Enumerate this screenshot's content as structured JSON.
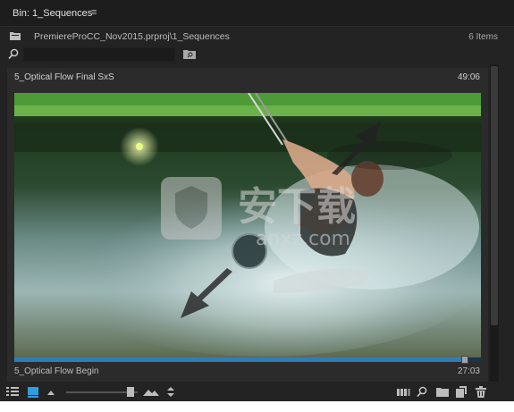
{
  "panel": {
    "tab_title": "Bin: 1_Sequences",
    "tab_menu_icon": "hamburger-menu-icon"
  },
  "pathbar": {
    "folder_icon": "bin-folder-icon",
    "path": "PremiereProCC_Nov2015.prproj\\1_Sequences",
    "item_count": "6 Items"
  },
  "search": {
    "value": "",
    "search_icon": "magnifier-icon",
    "new_bin_icon": "new-search-bin-icon"
  },
  "clip": {
    "name": "5_Optical Flow Final SxS",
    "duration": "49:06",
    "subtitle": "5_Optical Flow Begin",
    "subtitle_duration": "27:03",
    "playhead_position": 0.965,
    "accent_color": "#2f7db8"
  },
  "toolbar": {
    "list_view_icon": "list-view-icon",
    "icon_view_icon": "icon-view-icon",
    "sort_icon": "sort-triangle-icon",
    "zoom_small_icon": "mountain-small-icon",
    "zoom_large_icon": "mountain-large-icon",
    "zoom_level": 0.9,
    "sort_order_icon": "sort-updown-icon",
    "automate_icon": "automate-to-sequence-icon",
    "find_icon": "find-icon",
    "new_bin_icon": "new-bin-icon",
    "new_item_icon": "new-item-icon",
    "clear_icon": "trash-icon"
  }
}
